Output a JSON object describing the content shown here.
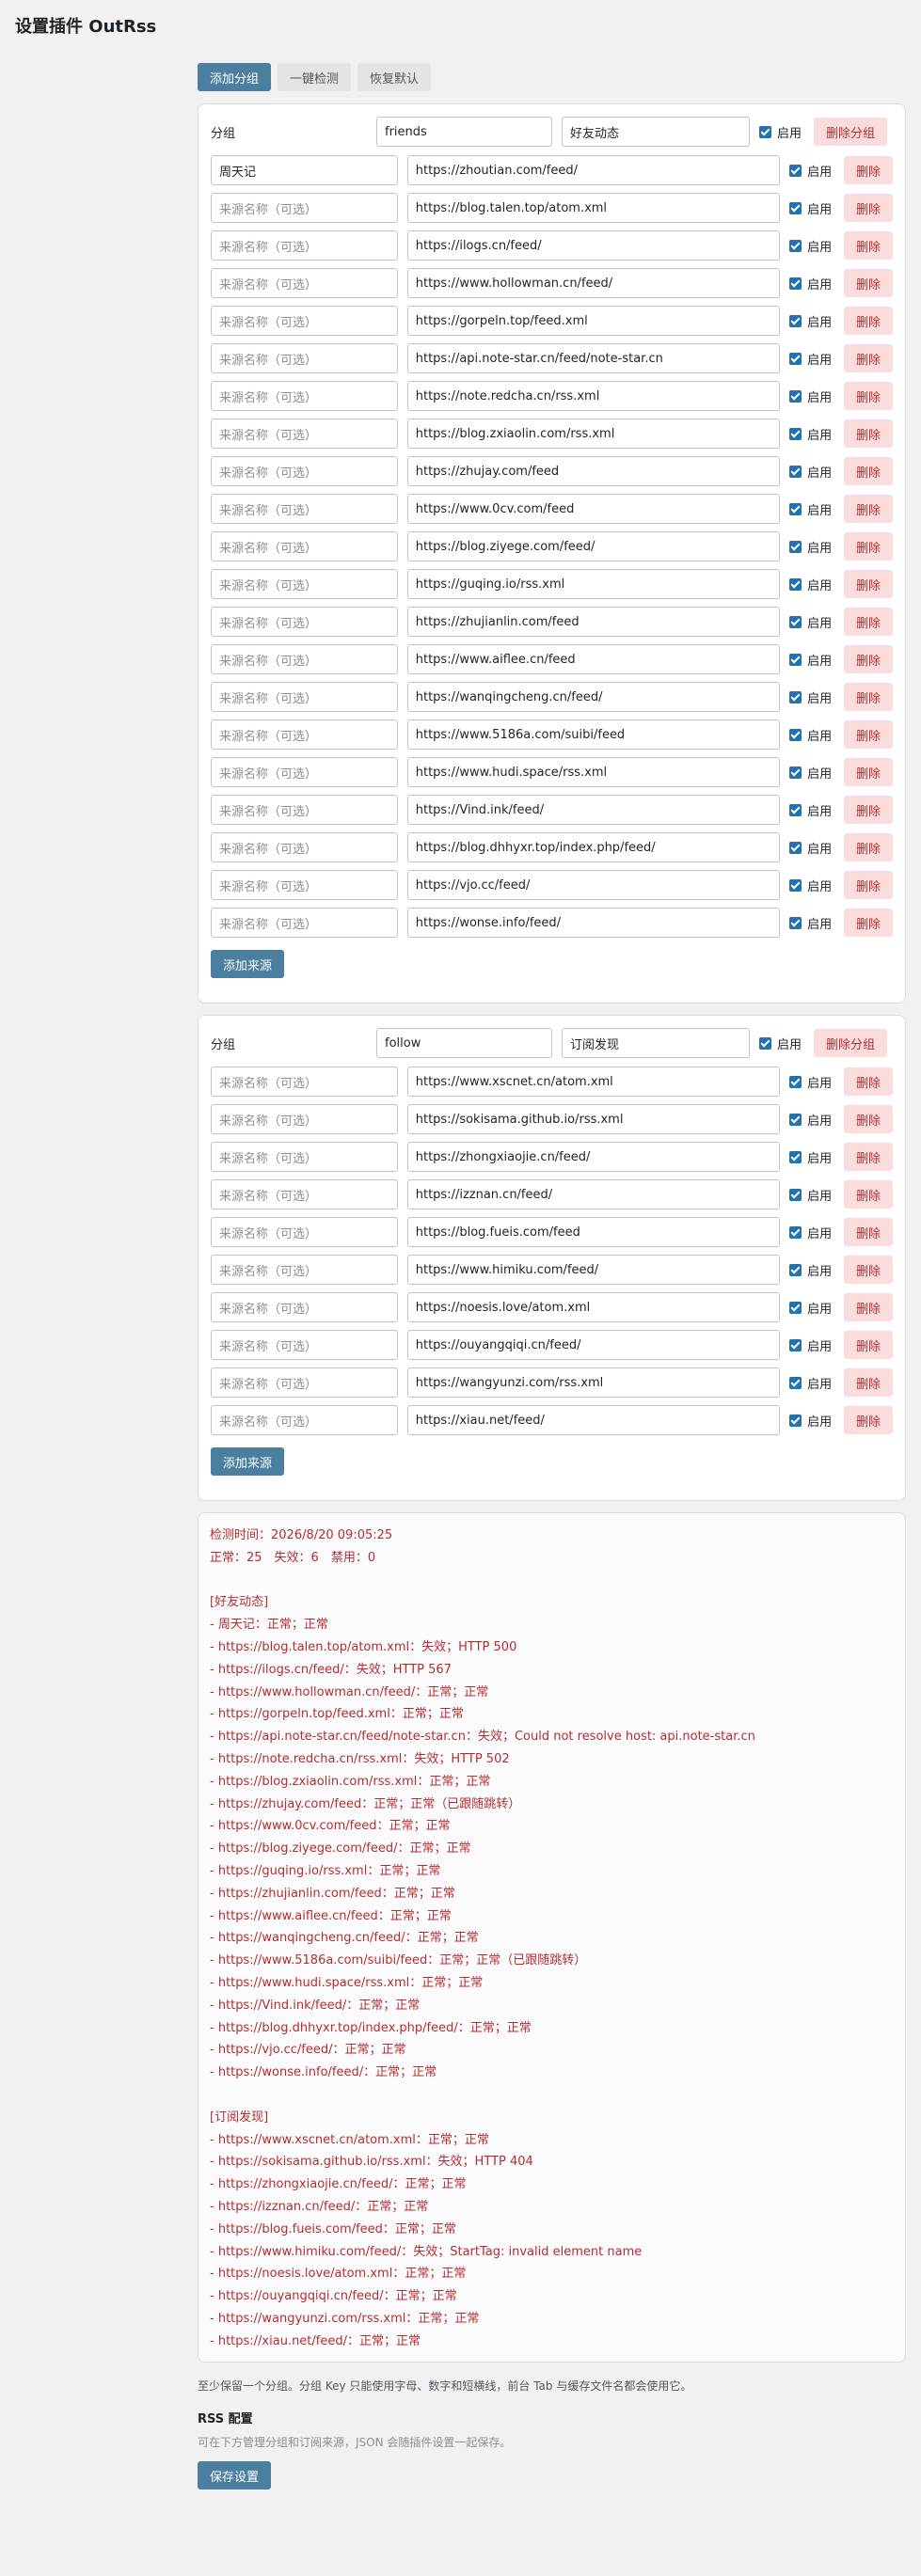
{
  "page": {
    "title": "设置插件 OutRss"
  },
  "toolbar": {
    "add_group": "添加分组",
    "check_all": "一键检测",
    "restore_default": "恢复默认"
  },
  "labels": {
    "group": "分组",
    "enable": "启用",
    "delete": "删除",
    "delete_group": "删除分组",
    "add_source": "添加来源",
    "name_placeholder": "来源名称（可选）"
  },
  "groups": [
    {
      "key": "friends",
      "title": "好友动态",
      "sources": [
        {
          "name": "周天记",
          "url": "https://zhoutian.com/feed/"
        },
        {
          "name": "",
          "url": "https://blog.talen.top/atom.xml"
        },
        {
          "name": "",
          "url": "https://ilogs.cn/feed/"
        },
        {
          "name": "",
          "url": "https://www.hollowman.cn/feed/"
        },
        {
          "name": "",
          "url": "https://gorpeln.top/feed.xml"
        },
        {
          "name": "",
          "url": "https://api.note-star.cn/feed/note-star.cn"
        },
        {
          "name": "",
          "url": "https://note.redcha.cn/rss.xml"
        },
        {
          "name": "",
          "url": "https://blog.zxiaolin.com/rss.xml"
        },
        {
          "name": "",
          "url": "https://zhujay.com/feed"
        },
        {
          "name": "",
          "url": "https://www.0cv.com/feed"
        },
        {
          "name": "",
          "url": "https://blog.ziyege.com/feed/"
        },
        {
          "name": "",
          "url": "https://guqing.io/rss.xml"
        },
        {
          "name": "",
          "url": "https://zhujianlin.com/feed"
        },
        {
          "name": "",
          "url": "https://www.aiflee.cn/feed"
        },
        {
          "name": "",
          "url": "https://wanqingcheng.cn/feed/"
        },
        {
          "name": "",
          "url": "https://www.5186a.com/suibi/feed"
        },
        {
          "name": "",
          "url": "https://www.hudi.space/rss.xml"
        },
        {
          "name": "",
          "url": "https://Vind.ink/feed/"
        },
        {
          "name": "",
          "url": "https://blog.dhhyxr.top/index.php/feed/"
        },
        {
          "name": "",
          "url": "https://vjo.cc/feed/"
        },
        {
          "name": "",
          "url": "https://wonse.info/feed/"
        }
      ]
    },
    {
      "key": "follow",
      "title": "订阅发现",
      "sources": [
        {
          "name": "",
          "url": "https://www.xscnet.cn/atom.xml"
        },
        {
          "name": "",
          "url": "https://sokisama.github.io/rss.xml"
        },
        {
          "name": "",
          "url": "https://zhongxiaojie.cn/feed/"
        },
        {
          "name": "",
          "url": "https://izznan.cn/feed/"
        },
        {
          "name": "",
          "url": "https://blog.fueis.com/feed"
        },
        {
          "name": "",
          "url": "https://www.himiku.com/feed/"
        },
        {
          "name": "",
          "url": "https://noesis.love/atom.xml"
        },
        {
          "name": "",
          "url": "https://ouyangqiqi.cn/feed/"
        },
        {
          "name": "",
          "url": "https://wangyunzi.com/rss.xml"
        },
        {
          "name": "",
          "url": "https://xiau.net/feed/"
        }
      ]
    }
  ],
  "log_lines": [
    "检测时间：2026/8/20 09:05:25",
    "正常：25　失效：6　禁用：0",
    "",
    "[好友动态]",
    "- 周天记：正常；正常",
    "- https://blog.talen.top/atom.xml：失效；HTTP 500",
    "- https://ilogs.cn/feed/：失效；HTTP 567",
    "- https://www.hollowman.cn/feed/：正常；正常",
    "- https://gorpeln.top/feed.xml：正常；正常",
    "- https://api.note-star.cn/feed/note-star.cn：失效；Could not resolve host: api.note-star.cn",
    "- https://note.redcha.cn/rss.xml：失效；HTTP 502",
    "- https://blog.zxiaolin.com/rss.xml：正常；正常",
    "- https://zhujay.com/feed：正常；正常（已跟随跳转）",
    "- https://www.0cv.com/feed：正常；正常",
    "- https://blog.ziyege.com/feed/：正常；正常",
    "- https://guqing.io/rss.xml：正常；正常",
    "- https://zhujianlin.com/feed：正常；正常",
    "- https://www.aiflee.cn/feed：正常；正常",
    "- https://wanqingcheng.cn/feed/：正常；正常",
    "- https://www.5186a.com/suibi/feed：正常；正常（已跟随跳转）",
    "- https://www.hudi.space/rss.xml：正常；正常",
    "- https://Vind.ink/feed/：正常；正常",
    "- https://blog.dhhyxr.top/index.php/feed/：正常；正常",
    "- https://vjo.cc/feed/：正常；正常",
    "- https://wonse.info/feed/：正常；正常",
    "",
    "[订阅发现]",
    "- https://www.xscnet.cn/atom.xml：正常；正常",
    "- https://sokisama.github.io/rss.xml：失效；HTTP 404",
    "- https://zhongxiaojie.cn/feed/：正常；正常",
    "- https://izznan.cn/feed/：正常；正常",
    "- https://blog.fueis.com/feed：正常；正常",
    "- https://www.himiku.com/feed/：失效；StartTag: invalid element name",
    "- https://noesis.love/atom.xml：正常；正常",
    "- https://ouyangqiqi.cn/feed/：正常；正常",
    "- https://wangyunzi.com/rss.xml：正常；正常",
    "- https://xiau.net/feed/：正常；正常"
  ],
  "footer": {
    "note": "至少保留一个分组。分组 Key 只能使用字母、数字和短横线，前台 Tab 与缓存文件名都会使用它。",
    "heading": "RSS 配置",
    "description": "可在下方管理分组和订阅来源，JSON 会随插件设置一起保存。",
    "save": "保存设置"
  },
  "colors": {
    "primary": "#4a7fa0",
    "danger_bg": "#fbdcdc",
    "danger_text": "#b32d2e",
    "checkbox": "#2271b1"
  }
}
